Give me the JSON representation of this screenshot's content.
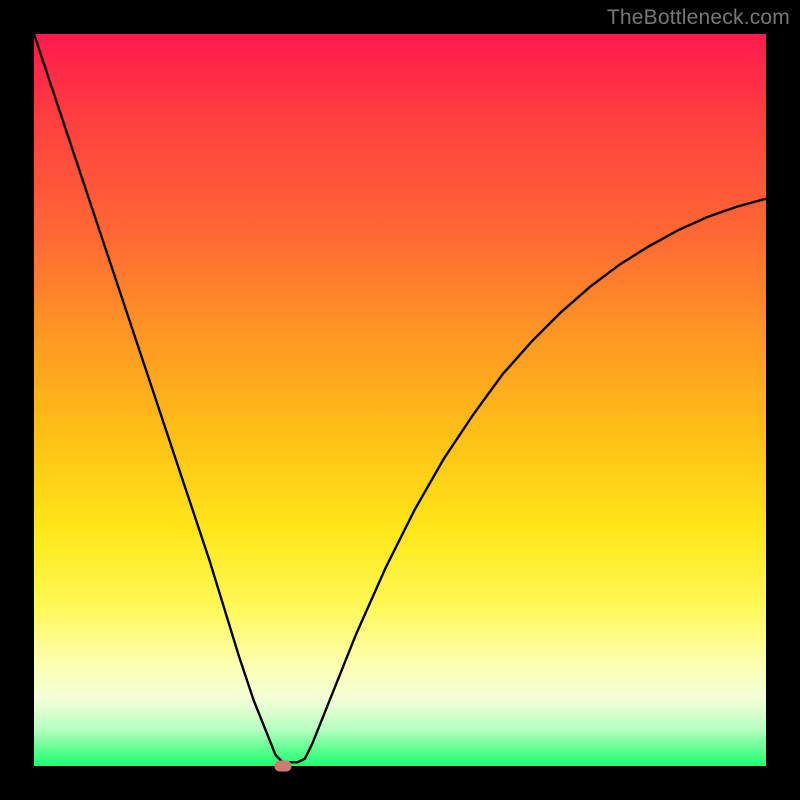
{
  "watermark": "TheBottleneck.com",
  "chart_data": {
    "type": "line",
    "title": "",
    "xlabel": "",
    "ylabel": "",
    "xlim": [
      0,
      100
    ],
    "ylim": [
      0,
      100
    ],
    "grid": false,
    "series": [
      {
        "name": "bottleneck-curve",
        "x": [
          0,
          4,
          8,
          12,
          16,
          20,
          24,
          28,
          30,
          32,
          33,
          34,
          36,
          37,
          38,
          40,
          44,
          48,
          52,
          56,
          60,
          64,
          68,
          72,
          76,
          80,
          84,
          88,
          92,
          96,
          100
        ],
        "y": [
          100,
          88,
          76,
          64,
          52,
          40,
          28,
          15,
          9,
          4,
          1.5,
          0.5,
          0.5,
          1,
          3,
          8,
          18,
          27,
          35,
          42,
          48,
          53.5,
          58,
          62,
          65.5,
          68.5,
          71,
          73.2,
          75,
          76.4,
          77.5
        ]
      }
    ],
    "marker": {
      "x": 34,
      "y": 0,
      "label": "optimal-point"
    },
    "background_gradient": {
      "top": "#ff1a4d",
      "upper_mid": "#ff9a22",
      "mid": "#ffe81a",
      "lower_mid": "#fdffb0",
      "bottom": "#1eff73"
    }
  }
}
